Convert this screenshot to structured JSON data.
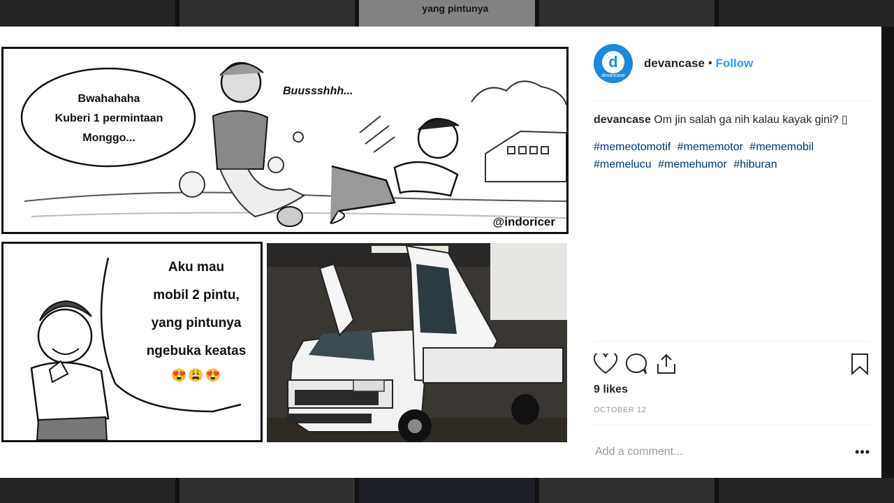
{
  "background": {
    "top_peek_text": "yang pintunya",
    "bottom_peek_text": ""
  },
  "post": {
    "comic": {
      "panel1_bubble": "Bwahahaha\nKuberi 1 permintaan\nMonggo...",
      "panel1_sfx": "Buussshhh...",
      "panel1_watermark": "@indoricer",
      "panel2_speech": "Aku mau\nmobil 2 pintu,\nyang pintunya\nngebuka keatas",
      "panel2_emojis": "😍😩😍"
    }
  },
  "sidebar": {
    "avatar_letter": "d",
    "avatar_caption": "devancase",
    "username": "devancase",
    "separator": "•",
    "follow_label": "Follow",
    "caption_user": "devancase",
    "caption_text": "Om jin salah ga nih kalau kayak gini? ▯",
    "hashtags": [
      "#memeotomotif",
      "#mememotor",
      "#mememobil",
      "#memelucu",
      "#memehumor",
      "#hiburan"
    ],
    "likes": "9 likes",
    "date": "OCTOBER 12",
    "comment_placeholder": "Add a comment...",
    "more_label": "•••"
  }
}
